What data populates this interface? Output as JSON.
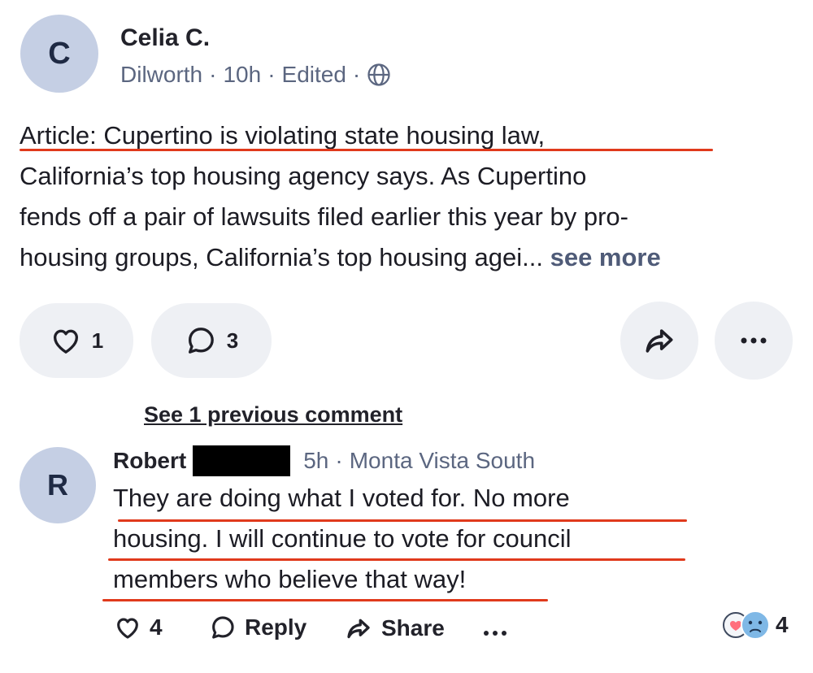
{
  "post": {
    "avatar_letter": "C",
    "author": "Celia C.",
    "neighborhood": "Dilworth",
    "time": "10h",
    "edited": "Edited",
    "sep": "·",
    "text_line1": "Article: Cupertino is violating state housing law,",
    "text_line2": "California’s top housing agency says. As Cupertino",
    "text_line3": "fends off a pair of lawsuits filed earlier this year by pro-",
    "text_line4": "housing groups, California’s top housing agei...",
    "see_more": " see more",
    "like_count": "1",
    "comment_count": "3"
  },
  "comments": {
    "see_previous": "See 1 previous comment",
    "avatar_letter": "R",
    "author": "Robert",
    "time": "5h",
    "neighborhood": "Monta Vista South",
    "sep": "·",
    "text_line1": "They are doing what I voted for.  No more",
    "text_line2": "housing.   I will continue to vote for council",
    "text_line3": "members who believe that way!",
    "like_count": "4",
    "reply_label": "Reply",
    "share_label": "Share",
    "reaction_count": "4"
  },
  "colors": {
    "accent_underline": "#e03a1c",
    "pill_bg": "#eef0f4",
    "avatar_bg": "#c5cfe4"
  }
}
